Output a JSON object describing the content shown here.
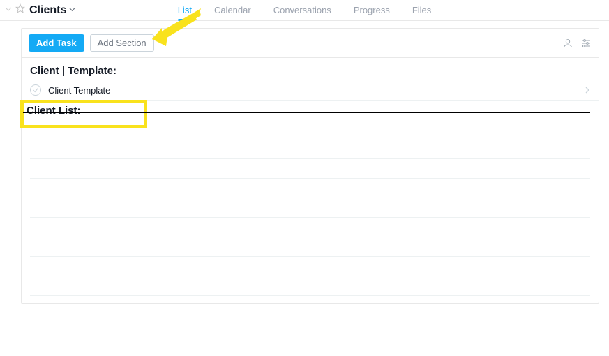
{
  "header": {
    "project_title": "Clients",
    "tabs": [
      {
        "label": "List",
        "active": true
      },
      {
        "label": "Calendar",
        "active": false
      },
      {
        "label": "Conversations",
        "active": false
      },
      {
        "label": "Progress",
        "active": false
      },
      {
        "label": "Files",
        "active": false
      }
    ]
  },
  "toolbar": {
    "add_task_label": "Add Task",
    "add_section_label": "Add Section"
  },
  "sections": [
    {
      "title": "Client | Template:",
      "tasks": [
        {
          "name": "Client Template"
        }
      ]
    },
    {
      "title": "Client List:",
      "tasks": [],
      "highlighted": true,
      "empty_rows": 8
    }
  ],
  "annotation": {
    "arrow_to": "add-section-button",
    "highlight": "client-list-section"
  }
}
